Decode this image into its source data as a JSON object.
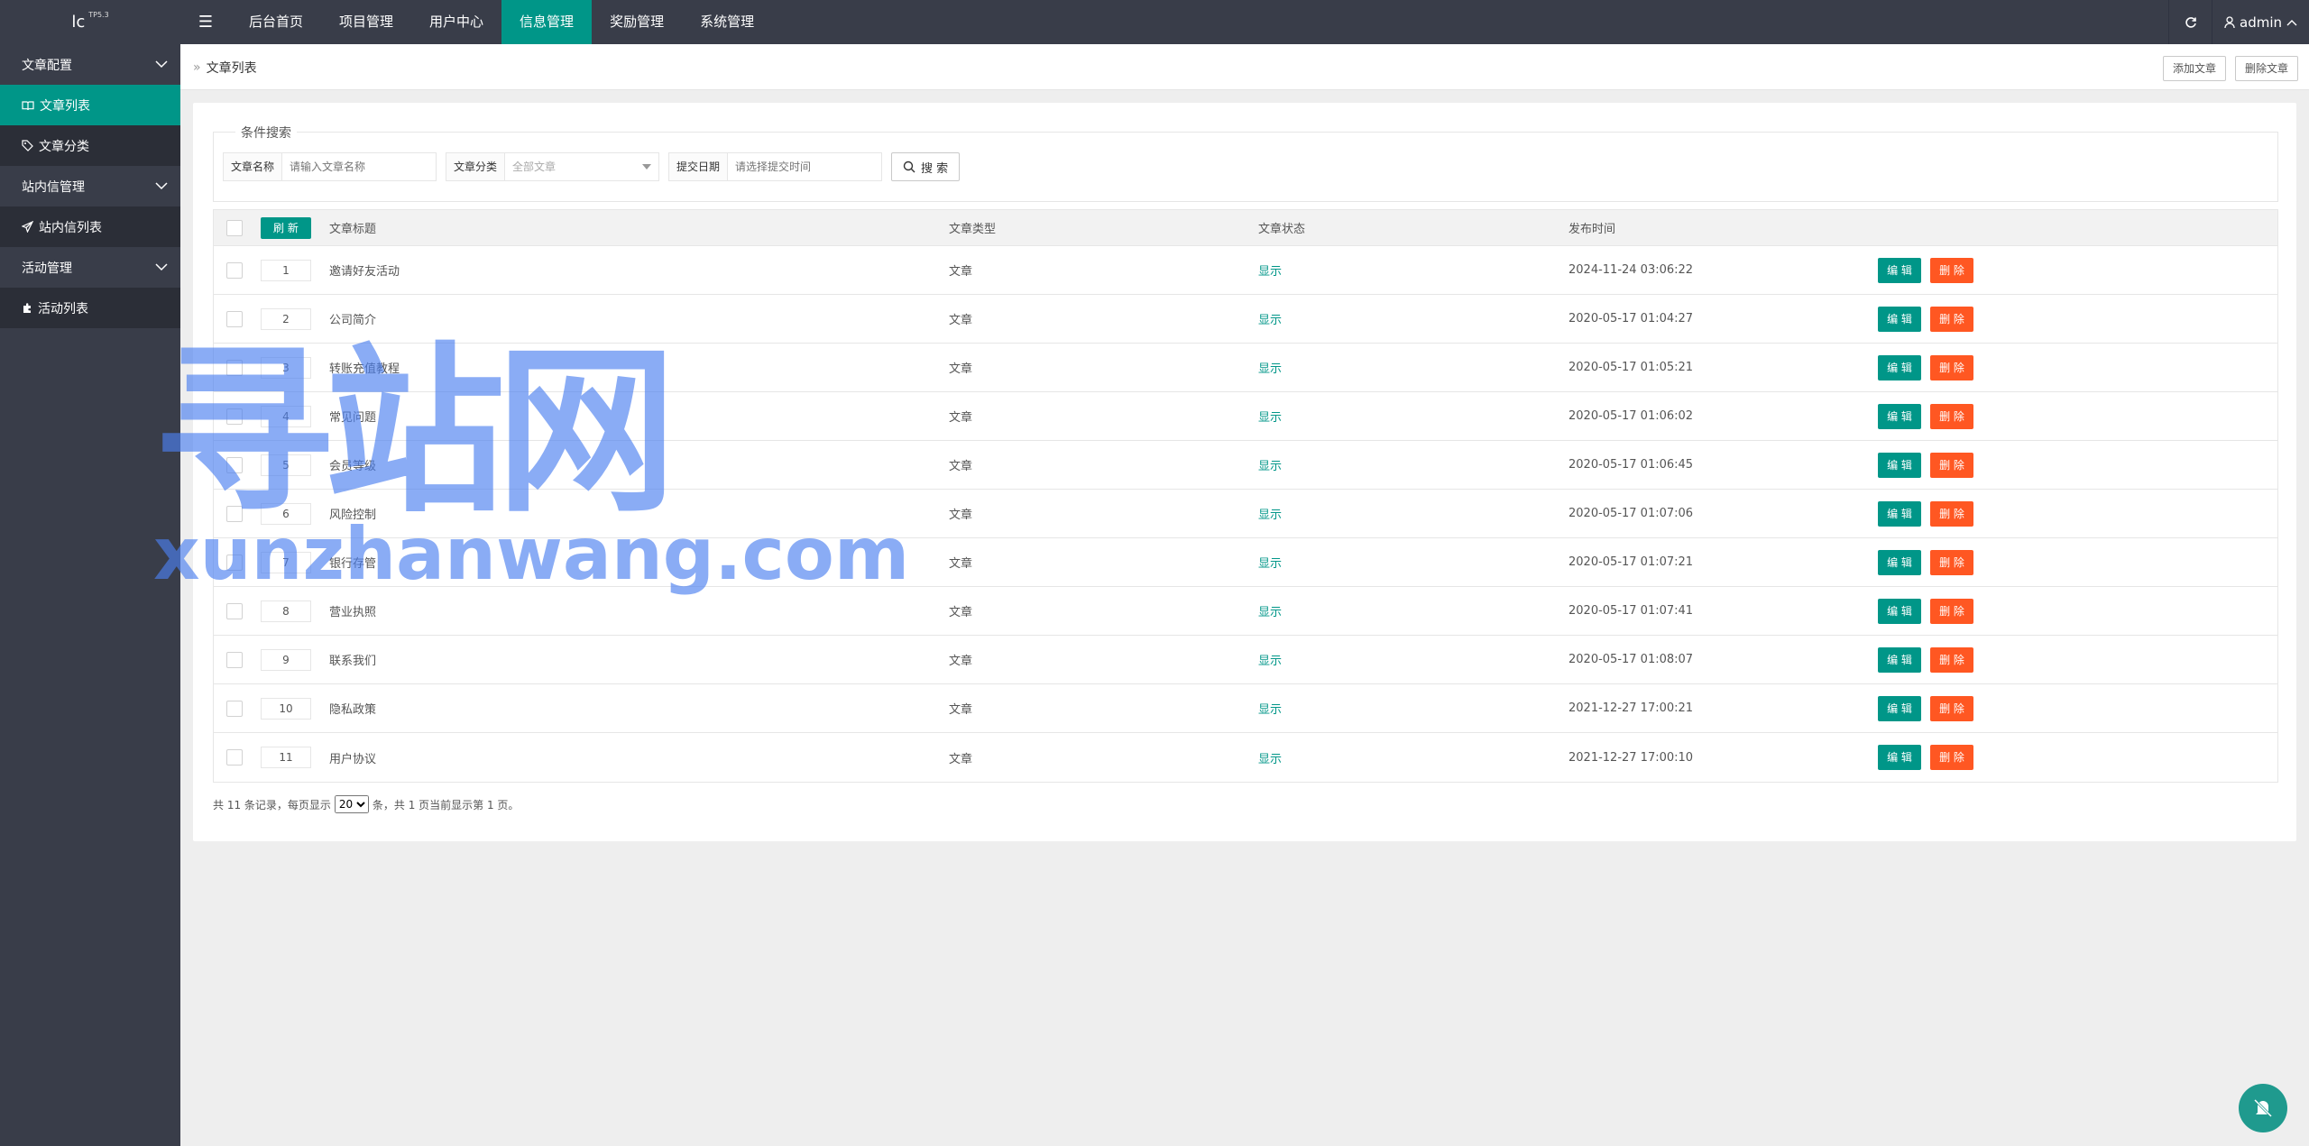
{
  "app": {
    "logo": "lc",
    "version": "TP5.3"
  },
  "nav": {
    "items": [
      {
        "label": "后台首页",
        "active": false
      },
      {
        "label": "项目管理",
        "active": false
      },
      {
        "label": "用户中心",
        "active": false
      },
      {
        "label": "信息管理",
        "active": true
      },
      {
        "label": "奖励管理",
        "active": false
      },
      {
        "label": "系统管理",
        "active": false
      }
    ],
    "user": "admin"
  },
  "sidebar": {
    "groups": [
      {
        "label": "文章配置",
        "items": [
          {
            "label": "文章列表",
            "icon": "book-icon",
            "active": true
          },
          {
            "label": "文章分类",
            "icon": "tag-icon",
            "active": false
          }
        ]
      },
      {
        "label": "站内信管理",
        "items": [
          {
            "label": "站内信列表",
            "icon": "paper-plane-icon",
            "active": false
          }
        ]
      },
      {
        "label": "活动管理",
        "items": [
          {
            "label": "活动列表",
            "icon": "puzzle-icon",
            "active": false
          }
        ]
      }
    ]
  },
  "breadcrumb": {
    "current": "文章列表",
    "add_label": "添加文章",
    "delete_label": "删除文章"
  },
  "search": {
    "legend": "条件搜索",
    "name_label": "文章名称",
    "name_placeholder": "请输入文章名称",
    "category_label": "文章分类",
    "category_value": "全部文章",
    "date_label": "提交日期",
    "date_placeholder": "请选择提交时间",
    "button": "搜 索"
  },
  "table": {
    "refresh_label": "刷 新",
    "headers": {
      "title": "文章标题",
      "type": "文章类型",
      "status": "文章状态",
      "time": "发布时间"
    },
    "edit_label": "编 辑",
    "delete_label": "删 除",
    "rows": [
      {
        "num": "1",
        "title": "邀请好友活动",
        "type": "文章",
        "status": "显示",
        "time": "2024-11-24 03:06:22"
      },
      {
        "num": "2",
        "title": "公司简介",
        "type": "文章",
        "status": "显示",
        "time": "2020-05-17 01:04:27"
      },
      {
        "num": "3",
        "title": "转账充值教程",
        "type": "文章",
        "status": "显示",
        "time": "2020-05-17 01:05:21"
      },
      {
        "num": "4",
        "title": "常见问题",
        "type": "文章",
        "status": "显示",
        "time": "2020-05-17 01:06:02"
      },
      {
        "num": "5",
        "title": "会员等级",
        "type": "文章",
        "status": "显示",
        "time": "2020-05-17 01:06:45"
      },
      {
        "num": "6",
        "title": "风险控制",
        "type": "文章",
        "status": "显示",
        "time": "2020-05-17 01:07:06"
      },
      {
        "num": "7",
        "title": "银行存管",
        "type": "文章",
        "status": "显示",
        "time": "2020-05-17 01:07:21"
      },
      {
        "num": "8",
        "title": "营业执照",
        "type": "文章",
        "status": "显示",
        "time": "2020-05-17 01:07:41"
      },
      {
        "num": "9",
        "title": "联系我们",
        "type": "文章",
        "status": "显示",
        "time": "2020-05-17 01:08:07"
      },
      {
        "num": "10",
        "title": "隐私政策",
        "type": "文章",
        "status": "显示",
        "time": "2021-12-27 17:00:21"
      },
      {
        "num": "11",
        "title": "用户协议",
        "type": "文章",
        "status": "显示",
        "time": "2021-12-27 17:00:10"
      }
    ]
  },
  "pager": {
    "prefix": "共 11 条记录，每页显示",
    "page_size": "20",
    "suffix": "条，共 1 页当前显示第 1 页。"
  },
  "watermark": {
    "text": "寻站网",
    "url": "xunzhanwang.com"
  },
  "colors": {
    "primary": "#009688",
    "danger": "#ff5722",
    "dark": "#393d49"
  }
}
